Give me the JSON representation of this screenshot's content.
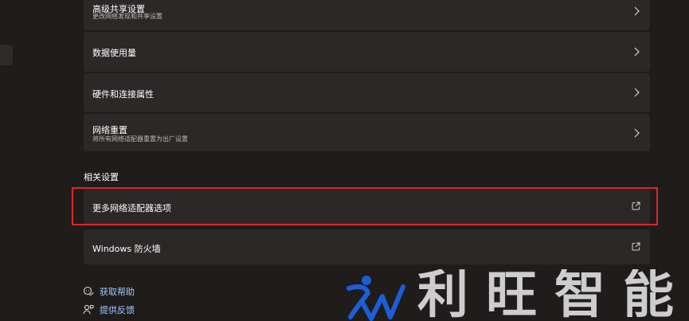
{
  "cards": [
    {
      "title": "高级共享设置",
      "subtitle": "更改网络发现和共享设置",
      "icon": "chevron-right-icon"
    },
    {
      "title": "数据使用量",
      "icon": "chevron-right-icon"
    },
    {
      "title": "硬件和连接属性",
      "icon": "chevron-right-icon"
    },
    {
      "title": "网络重置",
      "subtitle": "将所有网络适配器重置为出厂设置",
      "icon": "chevron-right-icon"
    }
  ],
  "related": {
    "section_title": "相关设置",
    "items": [
      {
        "title": "更多网络适配器选项",
        "icon": "external-link-icon"
      },
      {
        "title": "Windows 防火墙",
        "icon": "external-link-icon"
      }
    ]
  },
  "help": {
    "get_help": "获取帮助",
    "feedback": "提供反馈"
  },
  "watermark": {
    "text": "利旺智能"
  },
  "colors": {
    "background": "#201c1b",
    "card": "#2b2827",
    "highlight": "#e0261f",
    "link": "#9ec9ff",
    "logo_blue": "#1a5fd6"
  }
}
